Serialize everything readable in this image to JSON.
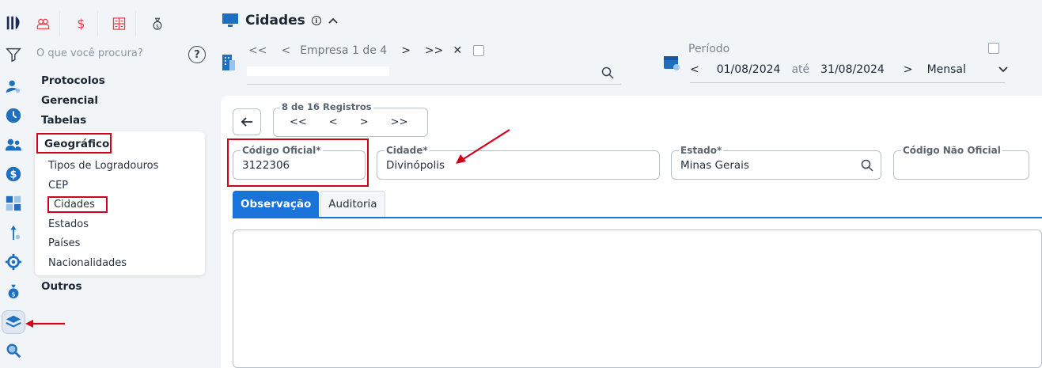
{
  "colors": {
    "accent": "#1a73d9",
    "highlight": "#d0021b",
    "logo": "#1c2a5a",
    "rail_icon": "#1f6fbf"
  },
  "rail": [
    "logo-icon",
    "filter-icon",
    "user-settings-icon",
    "clock-icon",
    "users-icon",
    "dollar-icon",
    "calculator-icon",
    "tool-icon",
    "gear-network-icon",
    "money-bag-icon",
    "layers-icon",
    "search-icon"
  ],
  "topicons": [
    "people-icon",
    "dollar-icon",
    "calculator-icon",
    "money-bag-icon"
  ],
  "search": {
    "placeholder": "O que você procura?",
    "help": "?"
  },
  "menu": {
    "protocolos": "Protocolos",
    "gerencial": "Gerencial",
    "tabelas": "Tabelas",
    "geografico": "Geográfico",
    "outros": "Outros"
  },
  "submenu": [
    "Tipos de Logradouros",
    "CEP",
    "Cidades",
    "Estados",
    "Países",
    "Nacionalidades"
  ],
  "header": {
    "title": "Cidades",
    "info": "i"
  },
  "empresa": {
    "first": "<<",
    "prev": "<",
    "label": "Empresa 1 de 4",
    "next": ">",
    "last": ">>",
    "clear": "✕"
  },
  "periodo": {
    "label": "Período",
    "prev": "<",
    "start": "01/08/2024",
    "ate": "até",
    "end": "31/08/2024",
    "next": ">",
    "mode": "Mensal"
  },
  "registros": {
    "label": "8 de 16 Registros",
    "first": "<<",
    "prev": "<",
    "next": ">",
    "last": ">>"
  },
  "form": {
    "codigo_label": "Código Oficial*",
    "codigo_value": "3122306",
    "cidade_label": "Cidade*",
    "cidade_value": "Divinópolis",
    "estado_label": "Estado*",
    "estado_value": "Minas Gerais",
    "nao_oficial_label": "Código Não Oficial",
    "nao_oficial_value": ""
  },
  "tabs": {
    "observacao": "Observação",
    "auditoria": "Auditoria"
  }
}
